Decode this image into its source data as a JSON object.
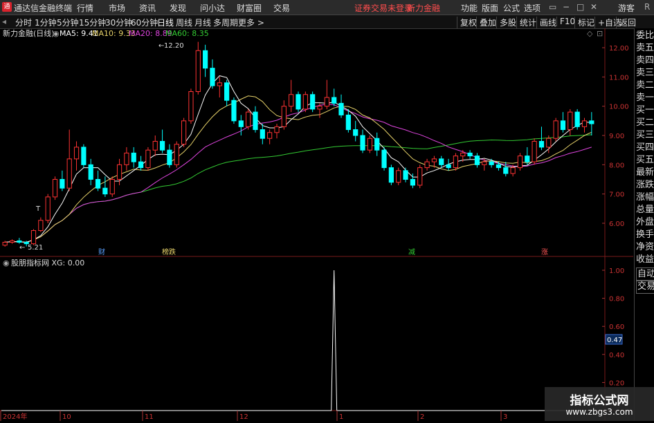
{
  "menubar": {
    "app_title": "通达信金融终端",
    "menus": [
      "行情",
      "市场",
      "资讯",
      "发现",
      "问小达",
      "财富圈",
      "交易"
    ],
    "trade_status": "证券交易未登录",
    "broker": "新力金融",
    "right_menus": [
      "功能",
      "版面",
      "公式",
      "选项"
    ],
    "guest": "游客",
    "right_flag": "R",
    "window_controls": [
      "▭",
      "−",
      "□",
      "✕"
    ]
  },
  "toolbar": {
    "periods": [
      "分时",
      "1分钟",
      "5分钟",
      "15分钟",
      "30分钟",
      "60分钟",
      "日线",
      "周线",
      "月线",
      "多周期",
      "更多 >"
    ],
    "active_period": "日线",
    "right_tabs": [
      "复权",
      "叠加",
      "多股",
      "统计",
      "画线",
      "F10",
      "标记",
      "+自选",
      "返回"
    ]
  },
  "main_chart": {
    "stock_label": "新力金融(日线)",
    "ma": [
      {
        "label": "MA5: 9.41",
        "color": "#ffffff"
      },
      {
        "label": "MA10: 9.33",
        "color": "#e8d36a"
      },
      {
        "label": "MA20: 8.89",
        "color": "#e045e0"
      },
      {
        "label": "MA60: 8.35",
        "color": "#33cc33"
      }
    ],
    "y_ticks": [
      "12.00",
      "11.00",
      "10.00",
      "9.00",
      "8.00",
      "7.00",
      "6.00"
    ],
    "high_label": "12.20",
    "low_label": "5.21",
    "markers": [
      {
        "text": "财",
        "color": "#5aa0ff"
      },
      {
        "text": "榜跌",
        "color": "#e8d36a"
      },
      {
        "text": "减",
        "color": "#33cc33"
      },
      {
        "text": "涨",
        "color": "#ff5555"
      }
    ],
    "t_label": "T"
  },
  "indicator": {
    "label": "股朋指标网 XG: 0.00",
    "y_ticks": [
      "1.00",
      "0.80",
      "0.60",
      "0.40",
      "0.20"
    ],
    "current_value": "0.47"
  },
  "x_axis": [
    "2024年",
    "10",
    "11",
    "12",
    "1",
    "2",
    "3"
  ],
  "sidebar": [
    "委比",
    "卖五",
    "卖四",
    "卖三",
    "卖二",
    "卖一",
    "买一",
    "买二",
    "买三",
    "买四",
    "买五",
    "最新",
    "涨跌",
    "涨幅",
    "总量",
    "外盘",
    "换手",
    "净资",
    "收益",
    "自动",
    "交易"
  ],
  "watermark": {
    "title": "指标公式网",
    "url": "www.zbgs3.com"
  },
  "colors": {
    "up": "#ff3333",
    "down": "#00ffff",
    "ma5": "#ffffff",
    "ma10": "#e8d36a",
    "ma20": "#e045e0",
    "ma60": "#33cc33"
  },
  "chart_data": {
    "type": "candlestick",
    "ohlc": [
      [
        5.25,
        5.4,
        5.2,
        5.35
      ],
      [
        5.35,
        5.45,
        5.3,
        5.4
      ],
      [
        5.4,
        5.5,
        5.3,
        5.35
      ],
      [
        5.35,
        5.4,
        5.21,
        5.3
      ],
      [
        5.3,
        5.8,
        5.25,
        5.75
      ],
      [
        5.75,
        6.2,
        5.7,
        6.1
      ],
      [
        6.1,
        7.0,
        6.0,
        6.9
      ],
      [
        6.9,
        7.6,
        6.8,
        7.5
      ],
      [
        7.5,
        7.8,
        7.1,
        7.2
      ],
      [
        7.2,
        9.2,
        7.1,
        8.2
      ],
      [
        8.2,
        8.8,
        7.8,
        8.6
      ],
      [
        8.6,
        8.7,
        7.9,
        8.0
      ],
      [
        8.0,
        8.2,
        7.3,
        7.5
      ],
      [
        7.5,
        7.8,
        7.1,
        7.2
      ],
      [
        7.2,
        7.6,
        6.9,
        7.0
      ],
      [
        7.0,
        7.6,
        6.9,
        7.5
      ],
      [
        7.5,
        8.2,
        7.3,
        8.0
      ],
      [
        8.0,
        8.6,
        7.8,
        8.4
      ],
      [
        8.4,
        8.6,
        7.9,
        8.1
      ],
      [
        8.1,
        8.3,
        7.8,
        7.9
      ],
      [
        7.9,
        8.6,
        7.8,
        8.5
      ],
      [
        8.5,
        9.0,
        8.3,
        8.8
      ],
      [
        8.8,
        9.2,
        8.4,
        8.5
      ],
      [
        8.5,
        8.7,
        7.9,
        8.0
      ],
      [
        8.0,
        8.8,
        7.9,
        8.7
      ],
      [
        8.7,
        9.6,
        8.6,
        9.5
      ],
      [
        9.5,
        10.6,
        9.4,
        10.5
      ],
      [
        10.5,
        12.2,
        10.4,
        11.9
      ],
      [
        11.9,
        12.1,
        11.0,
        11.3
      ],
      [
        11.3,
        11.6,
        10.6,
        10.7
      ],
      [
        10.7,
        11.0,
        10.3,
        10.8
      ],
      [
        10.8,
        10.9,
        10.0,
        10.2
      ],
      [
        10.2,
        10.3,
        9.4,
        9.5
      ],
      [
        9.5,
        9.7,
        9.0,
        9.3
      ],
      [
        9.3,
        9.9,
        9.2,
        9.8
      ],
      [
        9.8,
        10.0,
        9.1,
        9.2
      ],
      [
        9.2,
        9.4,
        8.7,
        8.9
      ],
      [
        8.9,
        9.2,
        8.7,
        9.1
      ],
      [
        9.1,
        9.4,
        8.9,
        9.3
      ],
      [
        9.3,
        10.2,
        9.2,
        10.0
      ],
      [
        10.0,
        10.9,
        9.8,
        10.4
      ],
      [
        10.4,
        10.5,
        9.8,
        9.9
      ],
      [
        9.9,
        10.5,
        9.8,
        10.4
      ],
      [
        10.4,
        10.5,
        9.8,
        9.9
      ],
      [
        9.9,
        10.1,
        9.6,
        10.0
      ],
      [
        10.0,
        10.9,
        9.9,
        10.3
      ],
      [
        10.3,
        10.6,
        10.0,
        10.1
      ],
      [
        10.1,
        10.4,
        9.6,
        9.7
      ],
      [
        9.7,
        9.9,
        9.1,
        9.2
      ],
      [
        9.2,
        9.5,
        8.8,
        9.0
      ],
      [
        9.0,
        9.2,
        8.4,
        8.5
      ],
      [
        8.5,
        9.0,
        8.4,
        8.9
      ],
      [
        8.9,
        9.1,
        8.3,
        8.5
      ],
      [
        8.5,
        8.6,
        7.8,
        7.9
      ],
      [
        7.9,
        8.0,
        7.3,
        7.4
      ],
      [
        7.4,
        7.9,
        7.3,
        7.8
      ],
      [
        7.8,
        7.9,
        7.4,
        7.5
      ],
      [
        7.5,
        7.7,
        7.2,
        7.3
      ],
      [
        7.3,
        8.0,
        7.2,
        7.9
      ],
      [
        7.9,
        8.2,
        7.8,
        8.1
      ],
      [
        8.1,
        8.3,
        7.9,
        8.2
      ],
      [
        8.2,
        8.3,
        7.9,
        8.0
      ],
      [
        8.0,
        8.2,
        7.8,
        7.9
      ],
      [
        7.9,
        8.4,
        7.8,
        8.3
      ],
      [
        8.3,
        8.5,
        8.1,
        8.4
      ],
      [
        8.4,
        8.5,
        8.2,
        8.3
      ],
      [
        8.3,
        8.4,
        7.9,
        8.0
      ],
      [
        8.0,
        8.2,
        7.8,
        8.1
      ],
      [
        8.1,
        8.2,
        7.9,
        8.0
      ],
      [
        8.0,
        8.1,
        7.8,
        7.9
      ],
      [
        7.9,
        8.1,
        7.6,
        7.7
      ],
      [
        7.7,
        8.0,
        7.6,
        7.9
      ],
      [
        7.9,
        8.4,
        7.8,
        8.3
      ],
      [
        8.3,
        8.6,
        8.0,
        8.1
      ],
      [
        8.1,
        8.9,
        8.0,
        8.8
      ],
      [
        8.8,
        9.3,
        8.5,
        8.6
      ],
      [
        8.6,
        9.0,
        8.4,
        8.9
      ],
      [
        8.9,
        9.6,
        8.8,
        9.5
      ],
      [
        9.5,
        9.8,
        9.1,
        9.2
      ],
      [
        9.2,
        9.9,
        9.0,
        9.8
      ],
      [
        9.8,
        9.9,
        9.2,
        9.3
      ],
      [
        9.3,
        9.6,
        9.1,
        9.5
      ],
      [
        9.5,
        9.8,
        9.0,
        9.4
      ]
    ],
    "xg_spike_index": 46,
    "xg_spike_value": 1.0,
    "ylim": [
      5.0,
      12.5
    ],
    "xg_ylim": [
      0,
      1.0
    ]
  }
}
